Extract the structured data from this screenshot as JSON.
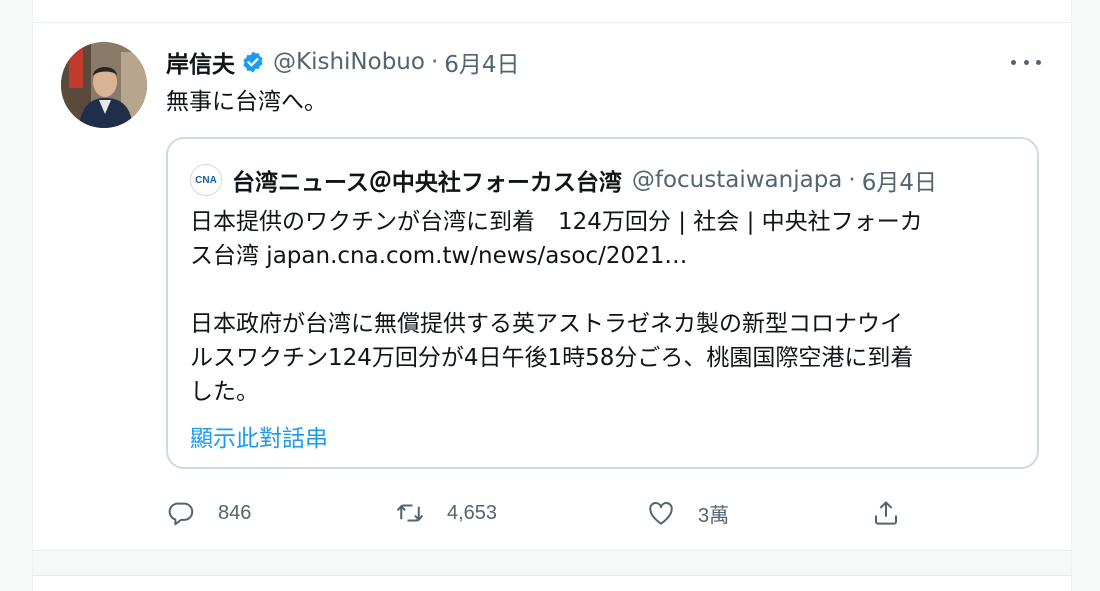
{
  "tweet": {
    "display_name": "岸信夫",
    "handle": "@KishiNobuo",
    "separator": "·",
    "date": "6月4日",
    "text": "無事に台湾へ。",
    "verified": true,
    "avatar_icon": "profile-photo"
  },
  "quote": {
    "logo_text": "CNA",
    "display_name": "台湾ニュース＠中央社フォーカス台湾",
    "handle": "@focustaiwanjapa",
    "separator": "·",
    "date": "6月4日",
    "lines": [
      "日本提供のワクチンが台湾に到着　124万回分 | 社会 | 中央社フォーカ",
      "ス台湾 japan.cna.com.tw/news/asoc/2021…",
      "",
      "日本政府が台湾に無償提供する英アストラゼネカ製の新型コロナウイ",
      "ルスワクチン124万回分が4日午後1時58分ごろ、桃園国際空港に到着",
      "した。"
    ],
    "thread_link": "顯示此對話串"
  },
  "actions": {
    "reply": {
      "icon": "reply-icon",
      "count": "846"
    },
    "retweet": {
      "icon": "retweet-icon",
      "count": "4,653"
    },
    "like": {
      "icon": "heart-icon",
      "count": "3萬"
    },
    "share": {
      "icon": "share-icon"
    }
  },
  "colors": {
    "text": "#0f1419",
    "secondary": "#536471",
    "link": "#1d9bf0",
    "border": "#cfd9de"
  }
}
